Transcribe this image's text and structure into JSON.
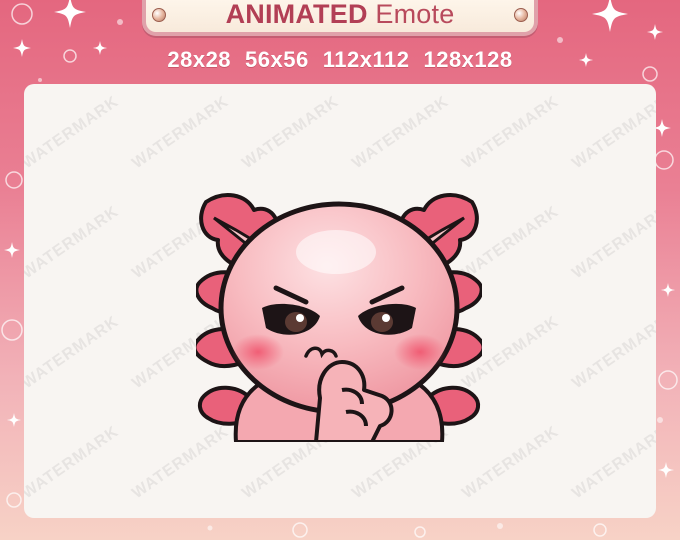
{
  "banner": {
    "title_bold": "ANIMATED",
    "title_light": "Emote"
  },
  "sizes": [
    "28x28",
    "56x56",
    "112x112",
    "128x128"
  ],
  "watermark_text": "WATERMARK",
  "colors": {
    "background_top": "#e4677f",
    "background_bottom": "#f7d2c6",
    "banner_text": "#b23f55",
    "card": "#f8f5f2",
    "axolotl_skin": "#f6b3b8",
    "gills": "#e9617a"
  },
  "icons": [
    "sparkle-icon",
    "bubble-icon",
    "pin-icon"
  ]
}
